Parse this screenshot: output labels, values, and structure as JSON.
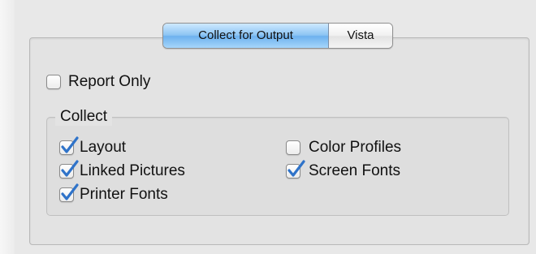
{
  "tabs": [
    {
      "label": "Collect for Output",
      "selected": true
    },
    {
      "label": "Vista",
      "selected": false
    }
  ],
  "report_only": {
    "label": "Report Only",
    "checked": false
  },
  "collect_group": {
    "title": "Collect",
    "options": [
      {
        "label": "Layout",
        "checked": true
      },
      {
        "label": "Linked Pictures",
        "checked": true
      },
      {
        "label": "Printer Fonts",
        "checked": true
      },
      {
        "label": "Color Profiles",
        "checked": false
      },
      {
        "label": "Screen Fonts",
        "checked": true
      }
    ]
  },
  "colors": {
    "selected_tab": "#8cc4f3",
    "checkmark": "#2f73c9",
    "panel_background": "#e3e3e3"
  },
  "icons": {
    "checked": "checkmark-icon"
  }
}
